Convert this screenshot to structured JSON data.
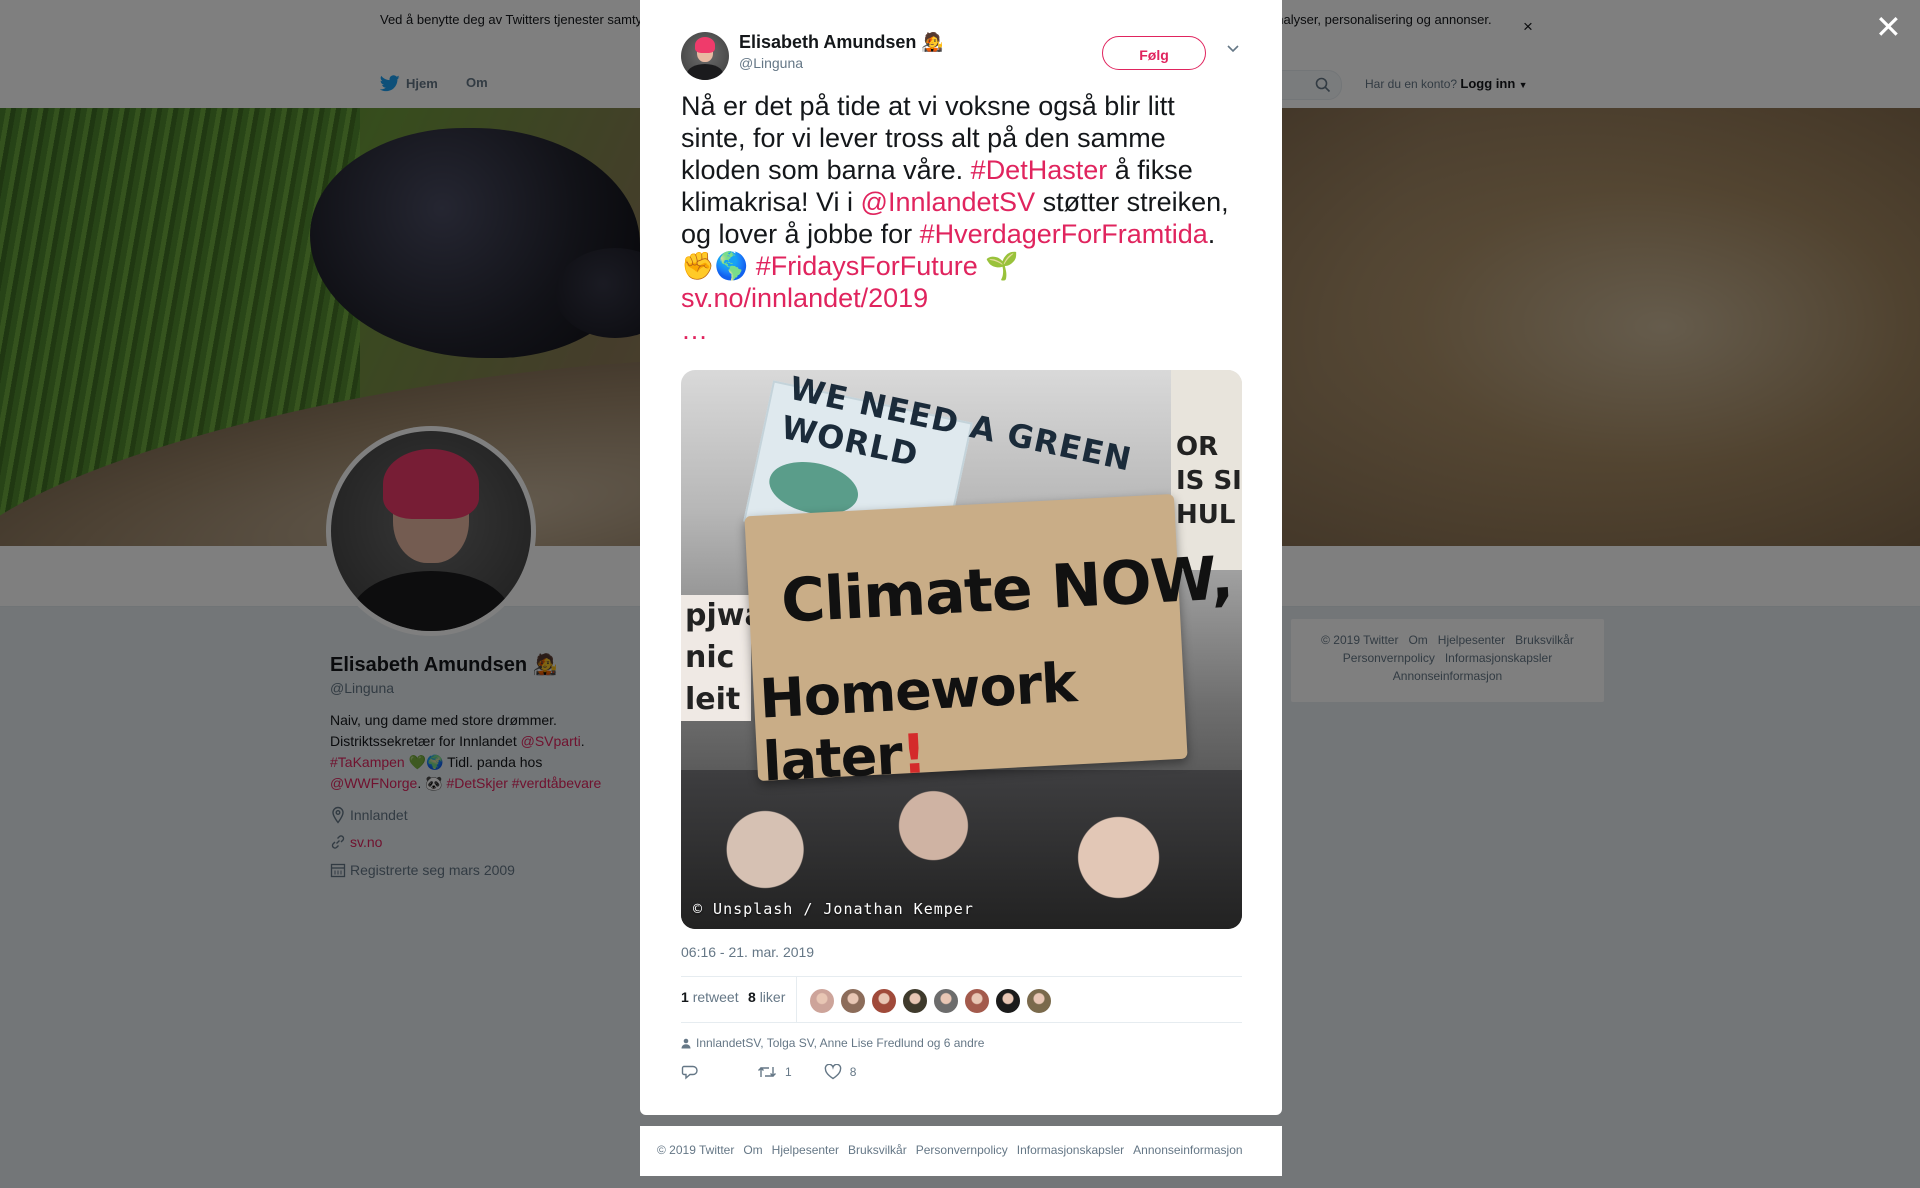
{
  "cookie": {
    "text": "Ved å benytte deg av Twitters tjenester samtykker du til bruken av informasjonskapsler. Twitter og partnere verden over bruker informasjonskapsler til bl.a. analyser, personalisering og annonser.",
    "close": "×"
  },
  "nav": {
    "home": "Hjem",
    "about": "Om",
    "login_prompt": "Har du en konto?",
    "login": "Logg inn"
  },
  "profile": {
    "name": "Elisabeth Amundsen 🧑‍🎤",
    "handle": "@Linguna",
    "bio": {
      "line1": "Naiv, ung dame med store drømmer.",
      "line2a": "Distriktssekretær for Innlandet ",
      "mention1": "@SVparti",
      "line2b": ".",
      "hashtag1": "#TaKampen",
      "line3b": " 💚🌍 Tidl. panda hos",
      "mention2": "@WWFNorge",
      "line4b": ". 🐼 ",
      "hashtag2": "#DetSkjer",
      "hashtag3": "#verdtåbevare"
    },
    "location": "Innlandet",
    "website": "sv.no",
    "joined": "Registrerte seg mars 2009"
  },
  "side_footer": {
    "copyright": "© 2019 Twitter",
    "about": "Om",
    "help": "Hjelpesenter",
    "terms": "Bruksvilkår",
    "privacy": "Personvernpolicy",
    "cookies": "Informasjonskapsler",
    "ads": "Annonseinformasjon"
  },
  "tweet": {
    "fullname": "Elisabeth Amundsen 🧑‍🎤",
    "handle": "@Linguna",
    "follow": "Følg",
    "text": {
      "p1": "Nå er det på tide at vi voksne også blir litt sinte, for vi lever tross alt på den samme kloden som barna våre. ",
      "tag1": "#DetHaster",
      "p2": " å fikse klimakrisa! Vi i ",
      "mention": "@InnlandetSV",
      "p3": " støtter streiken, og lover å jobbe for ",
      "tag2": "#HverdagerForFramtida",
      "p4": ". ✊🌎 ",
      "tag3": "#FridaysForFuture",
      "p5": " 🌱 ",
      "url": "sv.no/innlandet/2019",
      "ellipsis": "…"
    },
    "media": {
      "sign_back": "WE NEED A GREEN WORLD",
      "sign_main_1": "Climate NOW,",
      "sign_main_2": "Homework later",
      "sign_main_bang": "!",
      "sign_right": "OR IS SI HUL",
      "sign_left": "pjwaw nic leit",
      "credit": "© Unsplash / Jonathan Kemper"
    },
    "timestamp": "06:16 - 21. mar. 2019",
    "retweets": "1",
    "retweets_label": "retweet",
    "likes": "8",
    "likes_label": "liker",
    "liker_colors": [
      "#cda49a",
      "#8c6c5a",
      "#a04a3a",
      "#3f3a2c",
      "#6c6c6c",
      "#a35a4c",
      "#1b1b1b",
      "#7a6a4c"
    ],
    "replying": "InnlandetSV, Tolga SV, Anne Lise Fredlund og 6 andre",
    "action_retweet_count": "1",
    "action_like_count": "8"
  },
  "modal_footer": {
    "copyright": "© 2019 Twitter",
    "about": "Om",
    "help": "Hjelpesenter",
    "terms": "Bruksvilkår",
    "privacy": "Personvernpolicy",
    "cookies": "Informasjonskapsler",
    "ads": "Annonseinformasjon"
  },
  "colors": {
    "link": "#e0245e",
    "overlay": "rgba(0,0,0,0.5)",
    "page_bg": "#e6ecf0"
  }
}
